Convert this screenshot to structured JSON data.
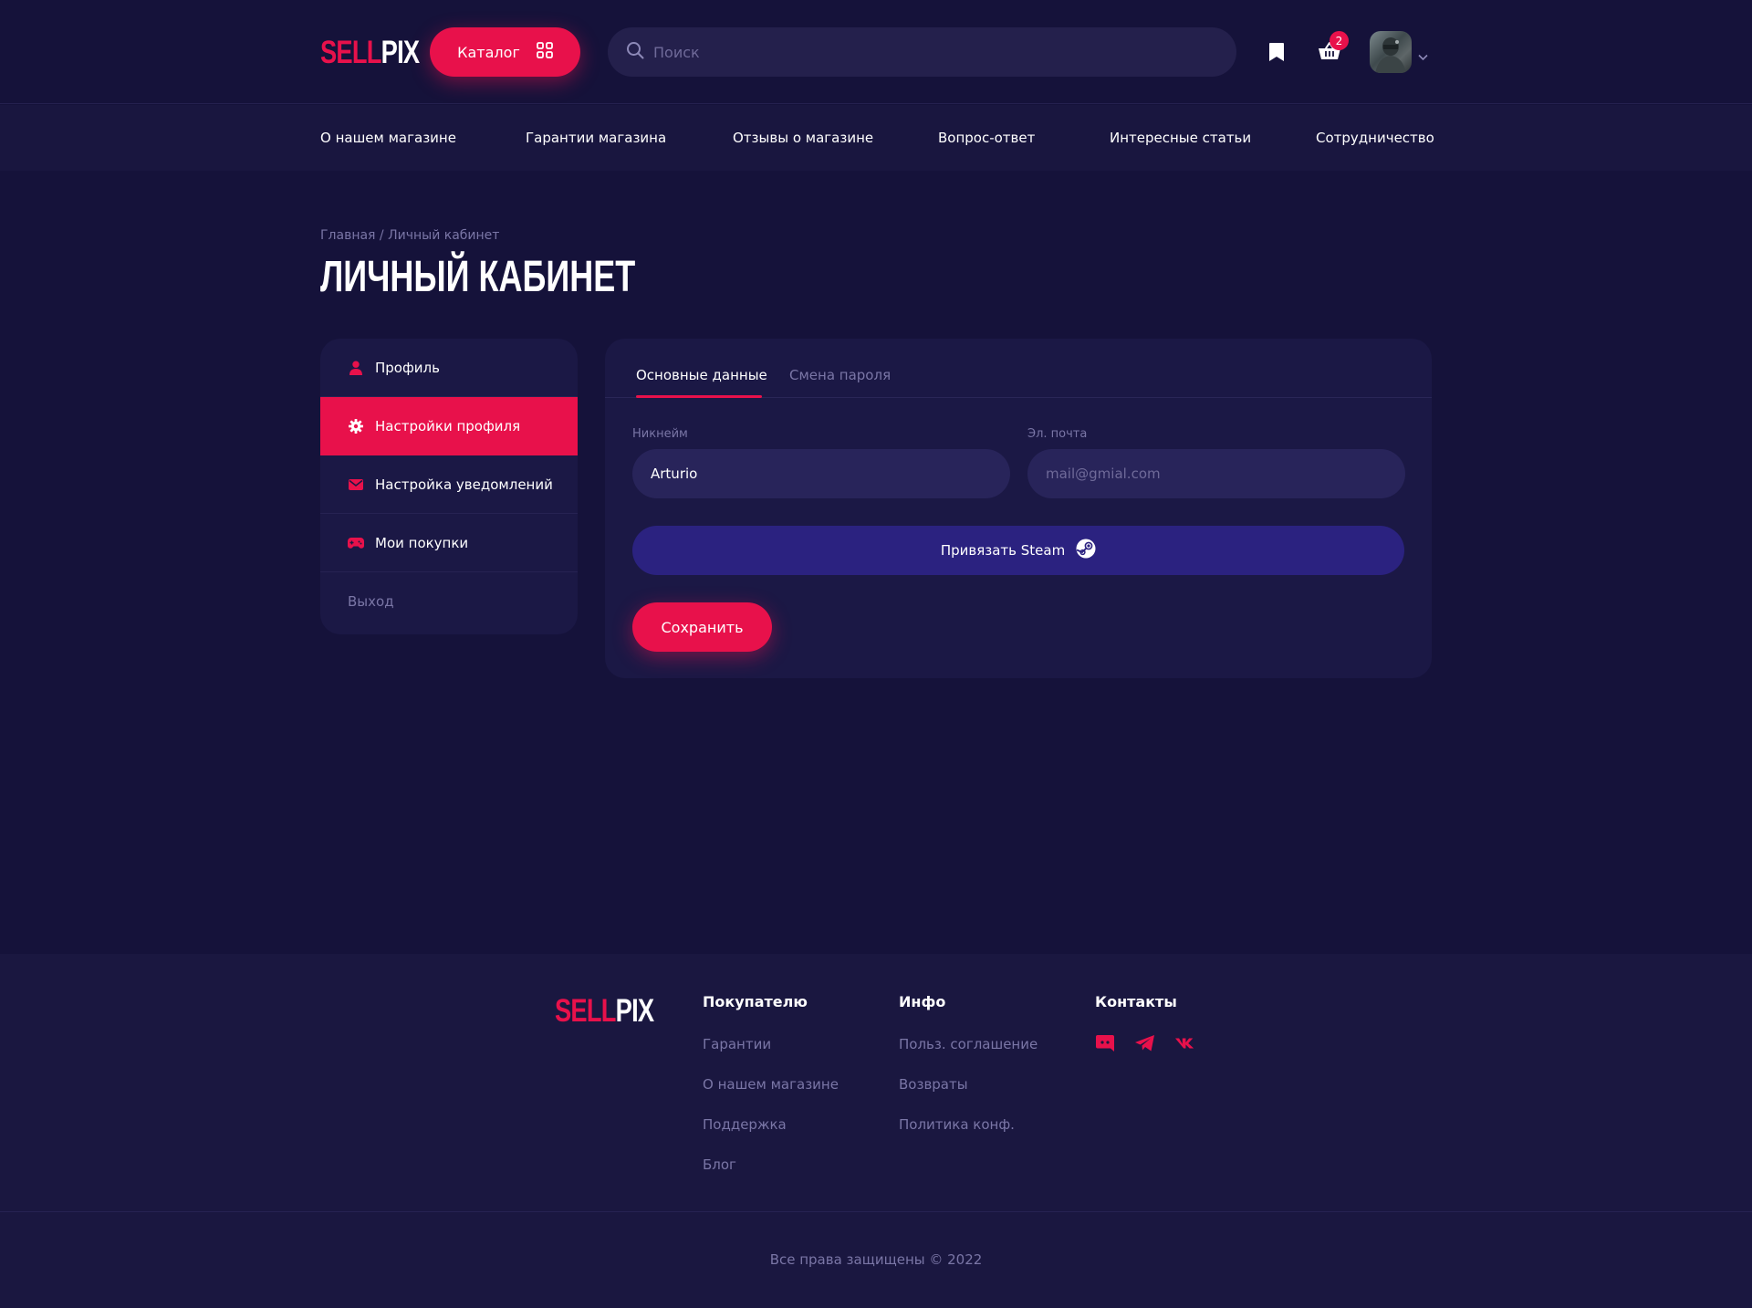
{
  "brand": {
    "logo_red": "SELL",
    "logo_white": "PIX",
    "accent": "#e8114b",
    "background": "#15123a"
  },
  "header": {
    "catalog_label": "Каталог",
    "search_placeholder": "Поиск",
    "cart_count": "2",
    "icons": [
      "grid-icon",
      "search-icon",
      "bookmark-icon",
      "basket-icon",
      "chevron-down-icon"
    ]
  },
  "nav": {
    "items": [
      {
        "label": "О нашем магазине"
      },
      {
        "label": "Гарантии магазина"
      },
      {
        "label": "Отзывы о магазине"
      },
      {
        "label": "Вопрос-ответ"
      },
      {
        "label": "Интересные статьи"
      },
      {
        "label": "Сотрудничество"
      }
    ]
  },
  "breadcrumb": {
    "home": "Главная",
    "separator": " / ",
    "current": "Личный кабинет"
  },
  "page_title": "ЛИЧНЫЙ КАБИНЕТ",
  "sidebar": {
    "items": [
      {
        "label": "Профиль",
        "icon": "user-icon"
      },
      {
        "label": "Настройки профиля",
        "icon": "gear-icon",
        "active": true
      },
      {
        "label": "Настройка уведомлений",
        "icon": "mail-icon"
      },
      {
        "label": "Мои покупки",
        "icon": "gamepad-icon"
      }
    ],
    "logout_label": "Выход"
  },
  "main": {
    "tabs": [
      {
        "label": "Основные данные",
        "active": true
      },
      {
        "label": "Смена пароля"
      }
    ],
    "nickname": {
      "label": "Никнейм",
      "value": "Arturio"
    },
    "email": {
      "label": "Эл. почта",
      "placeholder": "mail@gmial.com"
    },
    "steam_label": "Привязать Steam",
    "save_label": "Сохранить"
  },
  "footer": {
    "col1": {
      "title": "Покупателю",
      "links": [
        "Гарантии",
        "О нашем магазине",
        "Поддержка",
        "Блог"
      ]
    },
    "col2": {
      "title": "Инфо",
      "links": [
        "Польз. соглашение",
        "Возвраты",
        "Политика конф."
      ]
    },
    "col3": {
      "title": "Контакты",
      "socials": [
        "discord-icon",
        "telegram-icon",
        "vk-icon"
      ]
    },
    "copyright": "Все права защищены © 2022"
  }
}
